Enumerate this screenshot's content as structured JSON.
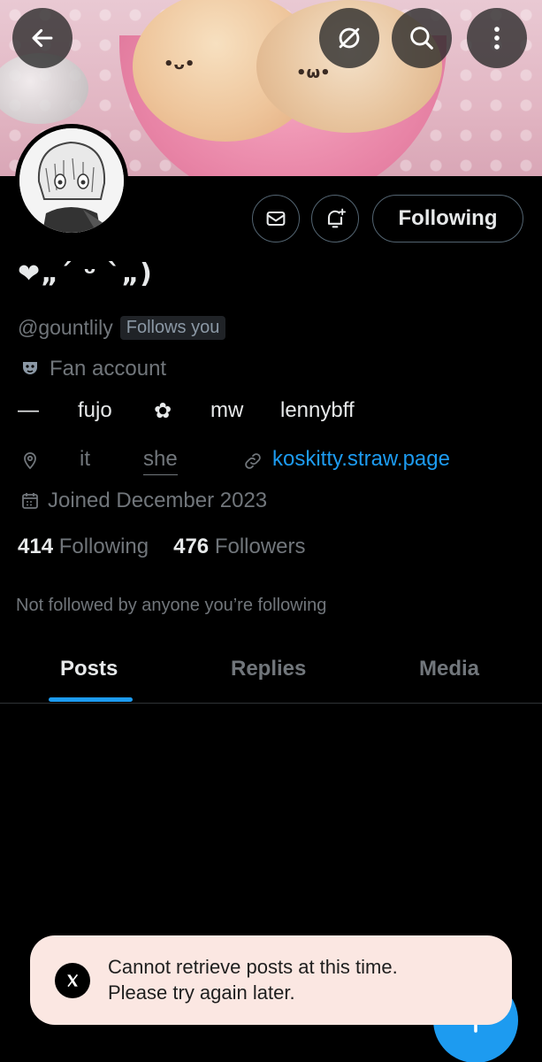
{
  "header": {
    "back_icon": "arrow-left-icon",
    "grok_icon": "slashed-circle-icon",
    "search_icon": "search-icon",
    "more_icon": "vertical-dots-icon",
    "banner_faces": [
      "•ᴗ•",
      "•ω•"
    ]
  },
  "profile": {
    "display_name": "❤︎„´ ᵕ `„)",
    "handle": "@gountlily",
    "follows_you": "Follows you",
    "category": "Fan account",
    "bio": {
      "dash": "—",
      "word1": "fujo",
      "flower": "✿",
      "word2": "mw",
      "word3": "lennybff"
    },
    "location": "it",
    "pronoun": "she",
    "website": "koskitty.straw.page",
    "joined": "Joined December 2023",
    "following_count": "414",
    "following_label": "Following",
    "followers_count": "476",
    "followers_label": "Followers",
    "not_followed": "Not followed by anyone you’re following"
  },
  "actions": {
    "following_label": "Following"
  },
  "tabs": [
    {
      "label": "Posts",
      "active": true
    },
    {
      "label": "Replies",
      "active": false
    },
    {
      "label": "Media",
      "active": false
    }
  ],
  "toast": {
    "line1": "Cannot retrieve posts at this time.",
    "line2": "Please try again later."
  },
  "colors": {
    "accent": "#1d9bf0",
    "background": "#000000",
    "toast_bg": "#fbe7e2"
  }
}
